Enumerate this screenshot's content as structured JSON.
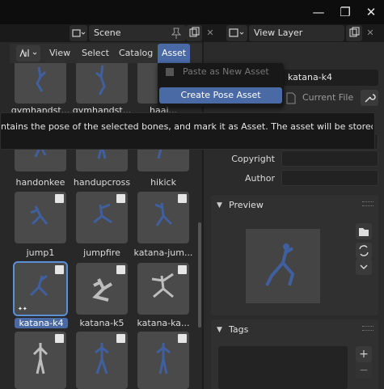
{
  "titlebar": {
    "minimize_glyph": "—",
    "maximize_glyph": "❐",
    "close_glyph": "✕"
  },
  "scene_row": {
    "scene_label": "Scene",
    "view_layer_label": "View Layer"
  },
  "asset_header": {
    "menus": [
      "View",
      "Select",
      "Catalog",
      "Asset"
    ],
    "active_menu": "Asset"
  },
  "asset_menu": {
    "items": [
      {
        "label": "Paste as New Asset",
        "enabled": false
      },
      {
        "label": "Create Pose Asset",
        "enabled": true,
        "highlighted": true
      }
    ]
  },
  "tooltip": {
    "text": "ntains the pose of the selected bones, and mark it as Asset. The asset will be stored in the"
  },
  "asset_grid": {
    "top_partial_labels": [
      "gymhandst...",
      "gymhandst...",
      "haai..."
    ],
    "rows": [
      [
        "handonkee",
        "handupcross",
        "hikick"
      ],
      [
        "jump1",
        "jumpfire",
        "katana-jum..."
      ],
      [
        "katana-k4",
        "katana-k5",
        "katana-ka..."
      ],
      [
        "",
        "",
        ""
      ]
    ],
    "selected": "katana-k4"
  },
  "properties": {
    "name_value": "katana-k4",
    "source_label": "Current File",
    "copyright_label": "Copyright",
    "author_label": "Author",
    "preview_header": "Preview",
    "tags_header": "Tags",
    "add_glyph": "+",
    "remove_glyph": "−"
  }
}
